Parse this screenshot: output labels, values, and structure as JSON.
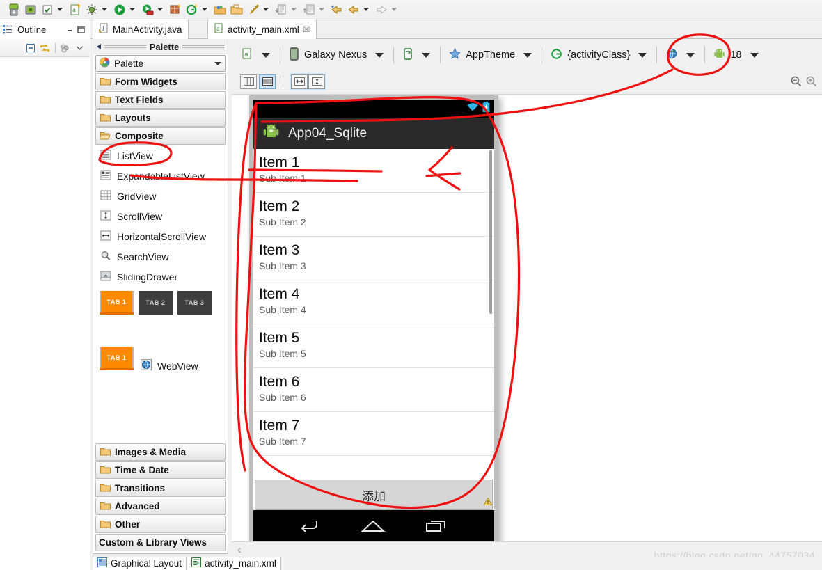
{
  "toolbar": {
    "items": [
      {
        "name": "android-sdk-manager-icon",
        "glyph": "▼",
        "has_arrow": false
      },
      {
        "name": "android-avd-manager-icon",
        "glyph": "",
        "has_arrow": false
      },
      {
        "name": "lint-check-icon",
        "glyph": "✓",
        "has_arrow": true
      },
      {
        "name": "new-android-xml-icon",
        "glyph": "",
        "has_arrow": false
      },
      {
        "name": "debug-icon",
        "glyph": "",
        "has_arrow": true
      },
      {
        "name": "run-icon",
        "glyph": "▶",
        "has_arrow": true
      },
      {
        "name": "run-external-icon",
        "glyph": "",
        "has_arrow": true
      },
      {
        "name": "new-wizard-icon",
        "glyph": "",
        "has_arrow": false
      },
      {
        "name": "new-project-icon",
        "glyph": "",
        "has_arrow": true
      },
      {
        "name": "open-type-icon",
        "glyph": "",
        "has_arrow": false
      },
      {
        "name": "open-resource-icon",
        "glyph": "",
        "has_arrow": false
      },
      {
        "name": "edit-icon",
        "glyph": "",
        "has_arrow": true
      },
      {
        "name": "import-icon",
        "glyph": "",
        "has_arrow": true
      },
      {
        "name": "export-icon",
        "glyph": "",
        "has_arrow": true
      },
      {
        "name": "back-history-icon",
        "glyph": "",
        "has_arrow": false
      },
      {
        "name": "back-icon",
        "glyph": "",
        "has_arrow": true
      },
      {
        "name": "forward-icon",
        "glyph": "",
        "has_arrow": true
      }
    ]
  },
  "outline": {
    "title": "Outline",
    "minimize_tooltip": "Minimize",
    "maximize_tooltip": "Maximize",
    "toolbar_buttons": [
      "collapse-all",
      "link-with-editor",
      "filters",
      "view-menu"
    ]
  },
  "editor_tabs": [
    {
      "label": "MainActivity.java",
      "icon": "java-file-icon",
      "active": false,
      "closable": false
    },
    {
      "label": "activity_main.xml",
      "icon": "xml-file-icon",
      "active": true,
      "closable": true,
      "close_glyph": "☒"
    }
  ],
  "palette": {
    "header_title": "Palette",
    "combo_label": "Palette",
    "groups_top": [
      {
        "label": "Form Widgets",
        "icon": "folder-icon",
        "open": false
      },
      {
        "label": "Text Fields",
        "icon": "folder-icon",
        "open": false
      },
      {
        "label": "Layouts",
        "icon": "folder-icon",
        "open": false
      },
      {
        "label": "Composite",
        "icon": "folder-open-icon",
        "open": true
      }
    ],
    "items": [
      {
        "label": "ListView",
        "icon": "listview-icon"
      },
      {
        "label": "ExpandableListView",
        "icon": "expandable-listview-icon"
      },
      {
        "label": "GridView",
        "icon": "gridview-icon"
      },
      {
        "label": "ScrollView",
        "icon": "scrollview-icon"
      },
      {
        "label": "HorizontalScrollView",
        "icon": "horizontal-scrollview-icon"
      },
      {
        "label": "SearchView",
        "icon": "search-icon"
      },
      {
        "label": "SlidingDrawer",
        "icon": "slidingdrawer-icon"
      }
    ],
    "tab_previews": [
      {
        "label": "TAB 1",
        "selected": true
      },
      {
        "label": "TAB 2",
        "selected": false
      },
      {
        "label": "TAB 3",
        "selected": false
      }
    ],
    "tabhost_preview": {
      "label": "TAB 1"
    },
    "webview": {
      "label": "WebView",
      "icon": "webview-globe-icon"
    },
    "groups_bottom": [
      {
        "label": "Images & Media",
        "icon": "folder-icon"
      },
      {
        "label": "Time & Date",
        "icon": "folder-icon"
      },
      {
        "label": "Transitions",
        "icon": "folder-icon"
      },
      {
        "label": "Advanced",
        "icon": "folder-icon"
      },
      {
        "label": "Other",
        "icon": "folder-icon"
      },
      {
        "label": "Custom & Library Views",
        "icon": "none"
      }
    ]
  },
  "config_bar": {
    "items": [
      {
        "name": "config-chooser",
        "label": "",
        "icon": "xml-config-icon",
        "has_caret": true
      },
      {
        "name": "device-chooser",
        "label": "Galaxy Nexus",
        "icon": "device-icon",
        "has_caret": true
      },
      {
        "name": "orientation-chooser",
        "label": "",
        "icon": "orientation-icon",
        "has_caret": true
      },
      {
        "name": "theme-chooser",
        "label": "AppTheme",
        "icon": "star-icon",
        "has_caret": true
      },
      {
        "name": "activity-chooser",
        "label": "{activityClass}",
        "icon": "activity-icon",
        "has_caret": true
      },
      {
        "name": "locale-chooser",
        "label": "",
        "icon": "globe-icon",
        "has_caret": true
      },
      {
        "name": "api-level-chooser",
        "label": "18",
        "icon": "android-icon",
        "has_caret": true
      }
    ]
  },
  "view_bar": {
    "buttons": [
      {
        "name": "show-included-in-toggle",
        "icon": "columns-icon",
        "active": false
      },
      {
        "name": "render-mode-toggle",
        "icon": "rows-icon",
        "active": true
      },
      {
        "name": "fit-width-button",
        "icon": "horizontal-arrows-icon",
        "active": true
      },
      {
        "name": "fit-height-button",
        "icon": "vertical-arrows-icon",
        "active": true
      }
    ],
    "zoom_out": "zoom-out-icon",
    "zoom_in": "zoom-in-icon"
  },
  "device_preview": {
    "app_title": "App04_Sqlite",
    "app_icon": "android-launcher-icon",
    "status_icons": [
      "wifi-icon",
      "battery-charging-icon"
    ],
    "list_items": [
      {
        "title": "Item 1",
        "subtitle": "Sub Item 1"
      },
      {
        "title": "Item 2",
        "subtitle": "Sub Item 2"
      },
      {
        "title": "Item 3",
        "subtitle": "Sub Item 3"
      },
      {
        "title": "Item 4",
        "subtitle": "Sub Item 4"
      },
      {
        "title": "Item 5",
        "subtitle": "Sub Item 5"
      },
      {
        "title": "Item 6",
        "subtitle": "Sub Item 6"
      },
      {
        "title": "Item 7",
        "subtitle": "Sub Item 7"
      }
    ],
    "add_button_label": "添加",
    "warning_icon": "warning-triangle-icon",
    "nav_buttons": [
      "back-nav-icon",
      "home-nav-icon",
      "recents-nav-icon"
    ]
  },
  "bottom_tabs": [
    {
      "label": "Graphical Layout",
      "icon": "graphical-layout-icon",
      "active": true
    },
    {
      "label": "activity_main.xml",
      "icon": "xml-source-icon",
      "active": false
    }
  ],
  "hscroll": {
    "left_arrow": "‹"
  },
  "watermark": {
    "text": "https://blog.csdn.net/qq_44757034"
  },
  "annotation_color": "#ee1111"
}
